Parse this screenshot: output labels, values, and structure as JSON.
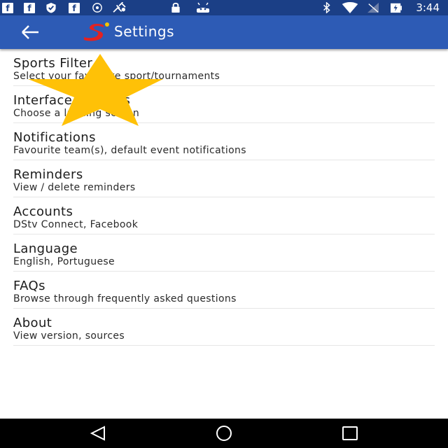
{
  "status_bar": {
    "time": "3:44",
    "left_icons": [
      "facebook-icon",
      "facebook-icon",
      "shield-icon",
      "facebook-icon",
      "sync-icon",
      "satellite-icon",
      "lock-icon",
      "android-icon"
    ],
    "right_icons": [
      "bluetooth-icon",
      "wifi-icon",
      "cellular-icon",
      "battery-charging-icon"
    ],
    "background": "#1b3f86"
  },
  "app_bar": {
    "title": "Settings",
    "back_icon": "arrow-left-icon",
    "logo_icon": "supersport-logo-icon",
    "background": "#2d5bb5"
  },
  "settings": [
    {
      "title": "Sports Filter",
      "subtitle": "Select your favourite sport/tournaments"
    },
    {
      "title": "Interface Settings",
      "subtitle": "Choose a landing screen"
    },
    {
      "title": "Notifications",
      "subtitle": "Favourite team(s), default event notifications"
    },
    {
      "title": "Reminders",
      "subtitle": "View / delete reminders"
    },
    {
      "title": "Accounts",
      "subtitle": "DStv Connect, Facebook"
    },
    {
      "title": "Language",
      "subtitle": "English, Portuguese"
    },
    {
      "title": "FAQs",
      "subtitle": "Browse through frequently asked questions"
    },
    {
      "title": "About",
      "subtitle": "View version, sources"
    }
  ],
  "overlay": {
    "icon": "star-icon",
    "color": "#ffc107"
  },
  "nav_bar": {
    "icons": [
      "back-triangle-icon",
      "home-circle-icon",
      "recents-square-icon"
    ],
    "background": "#000000"
  }
}
